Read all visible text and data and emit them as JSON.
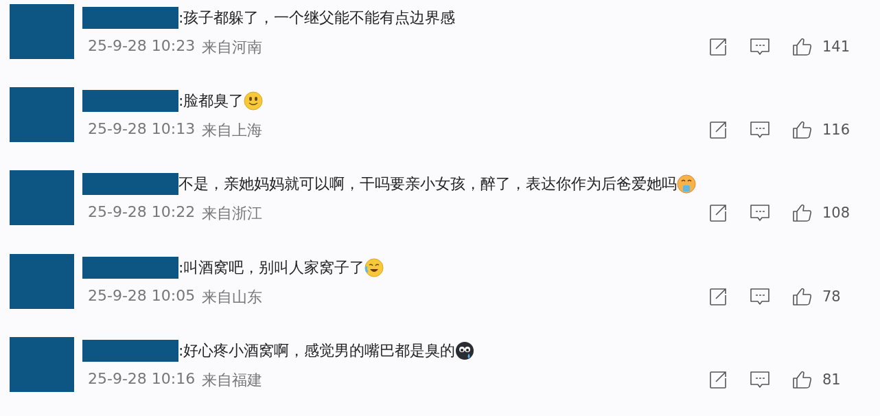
{
  "comments": [
    {
      "text": ":孩子都躲了，一个继父能不能有点边界感",
      "kind": "plain",
      "time": "25-9-28 10:23",
      "location": "来自河南",
      "likes": "141"
    },
    {
      "text": ":脸都臭了",
      "kind": "smile",
      "time": "25-9-28 10:13",
      "location": "来自上海",
      "likes": "116"
    },
    {
      "text": "不是，亲她妈妈就可以啊，干吗要亲小女孩，醉了，表达你作为后爸爱她吗",
      "kind": "drool",
      "time": "25-9-28 10:22",
      "location": "来自浙江",
      "likes": "108"
    },
    {
      "text": ":叫酒窝吧，别叫人家窝子了",
      "kind": "laughcry",
      "time": "25-9-28 10:05",
      "location": "来自山东",
      "likes": "78"
    },
    {
      "text": ":好心疼小酒窝啊，感觉男的嘴巴都是臭的",
      "kind": "sweat",
      "time": "25-9-28 10:16",
      "location": "来自福建",
      "likes": "81"
    }
  ]
}
